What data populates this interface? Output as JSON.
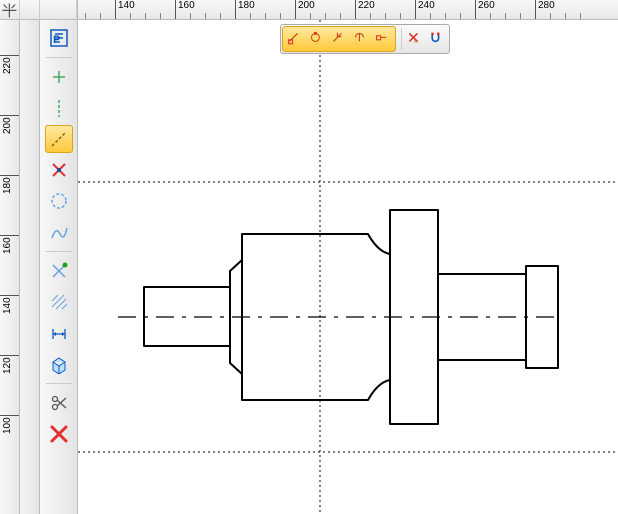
{
  "ruler_h": {
    "start": 120,
    "step": 20,
    "count": 9
  },
  "ruler_v": {
    "start": 220,
    "step": -20,
    "count": 7
  },
  "vertical_toolbar": [
    {
      "name": "paragraph-tool",
      "icon": "para"
    },
    {
      "name": "point-tool",
      "icon": "cross"
    },
    {
      "name": "vertical-line-tool",
      "icon": "dashv"
    },
    {
      "name": "axis-line-tool",
      "icon": "dashdiag",
      "active": true
    },
    {
      "name": "delete-point-tool",
      "icon": "redx-star"
    },
    {
      "name": "circle-tool",
      "icon": "circle"
    },
    {
      "name": "spline-tool",
      "icon": "spline"
    },
    {
      "name": "trim-tool",
      "icon": "greenx"
    },
    {
      "name": "hatch-tool",
      "icon": "hatch"
    },
    {
      "name": "dimension-tool",
      "icon": "dim"
    },
    {
      "name": "3d-box-tool",
      "icon": "box3d"
    },
    {
      "name": "cut-tool",
      "icon": "scissors"
    },
    {
      "name": "delete-tool",
      "icon": "bigredx"
    }
  ],
  "float_toolbar": {
    "group": [
      {
        "name": "snap-endpoint",
        "icon": "snap1"
      },
      {
        "name": "snap-midpoint",
        "icon": "snap2"
      },
      {
        "name": "snap-intersection",
        "icon": "snap3"
      },
      {
        "name": "snap-perpendicular",
        "icon": "snap4"
      },
      {
        "name": "snap-tangent",
        "icon": "snap5"
      }
    ],
    "extra": [
      {
        "name": "snap-off",
        "icon": "redxn"
      },
      {
        "name": "snap-magnet",
        "icon": "magnet"
      }
    ]
  },
  "colors": {
    "ruler_bg": "#eeeeee",
    "active_btn": "#ffc93a",
    "red": "#e03030",
    "blue": "#1058c0",
    "green": "#20a020"
  }
}
